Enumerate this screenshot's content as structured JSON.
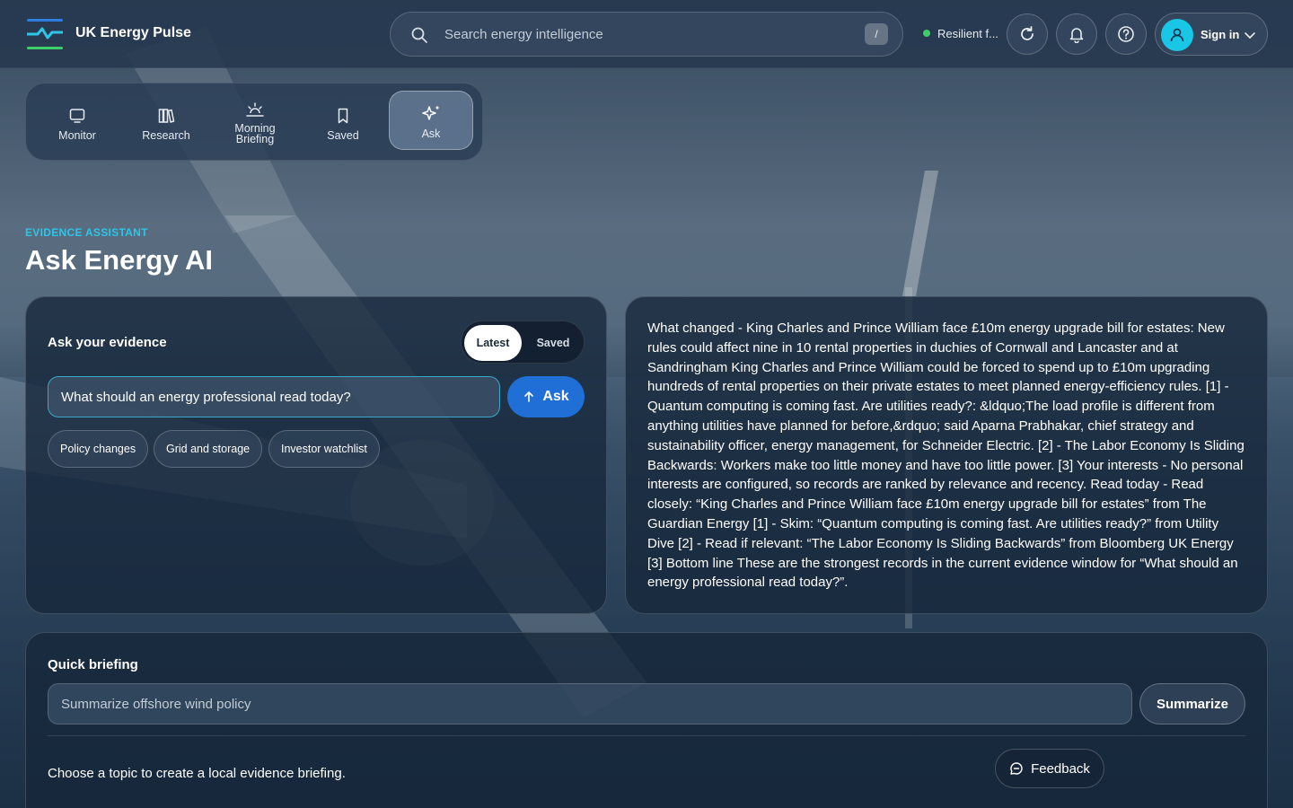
{
  "header": {
    "brand": "UK Energy Pulse",
    "search_placeholder": "Search energy intelligence",
    "search_shortcut": "/",
    "status_text": "Resilient f...",
    "signin_label": "Sign in"
  },
  "nav": {
    "items": [
      {
        "label": "Monitor"
      },
      {
        "label": "Research"
      },
      {
        "label_line1": "Morning",
        "label_line2": "Briefing"
      },
      {
        "label": "Saved"
      },
      {
        "label": "Ask"
      }
    ]
  },
  "page": {
    "eyebrow": "EVIDENCE ASSISTANT",
    "title": "Ask Energy AI"
  },
  "ask_panel": {
    "heading": "Ask your evidence",
    "toggle": {
      "latest": "Latest",
      "saved": "Saved"
    },
    "question_value": "What should an energy professional read today?",
    "ask_label": "Ask",
    "chips": [
      "Policy changes",
      "Grid and storage",
      "Investor watchlist"
    ]
  },
  "answer": {
    "text": "What changed - King Charles and Prince William face £10m energy upgrade bill for estates: New rules could affect nine in 10 rental properties in duchies of Cornwall and Lancaster and at Sandringham King Charles and Prince William could be forced to spend up to £10m upgrading hundreds of rental properties on their private estates to meet planned energy-efficiency rules. [1] - Quantum computing is coming fast. Are utilities ready?: &ldquo;The load profile is different from anything utilities have planned for before,&rdquo; said Aparna Prabhakar, chief strategy and sustainability officer, energy management, for Schneider Electric. [2] - The Labor Economy Is Sliding Backwards: Workers make too little money and have too little power. [3] Your interests - No personal interests are configured, so records are ranked by relevance and recency. Read today - Read closely: “King Charles and Prince William face £10m energy upgrade bill for estates” from The Guardian Energy [1] - Skim: “Quantum computing is coming fast. Are utilities ready?” from Utility Dive [2] - Read if relevant: “The Labor Economy Is Sliding Backwards” from Bloomberg UK Energy [3] Bottom line These are the strongest records in the current evidence window for “What should an energy professional read today?”."
  },
  "briefing": {
    "heading": "Quick briefing",
    "input_placeholder": "Summarize offshore wind policy",
    "summarize_label": "Summarize",
    "note": "Choose a topic to create a local evidence briefing."
  },
  "feedback": {
    "label": "Feedback"
  },
  "colors": {
    "accent_cyan": "#2ec5e8",
    "primary_blue": "#1f6fd6",
    "status_green": "#3ecf6a"
  }
}
